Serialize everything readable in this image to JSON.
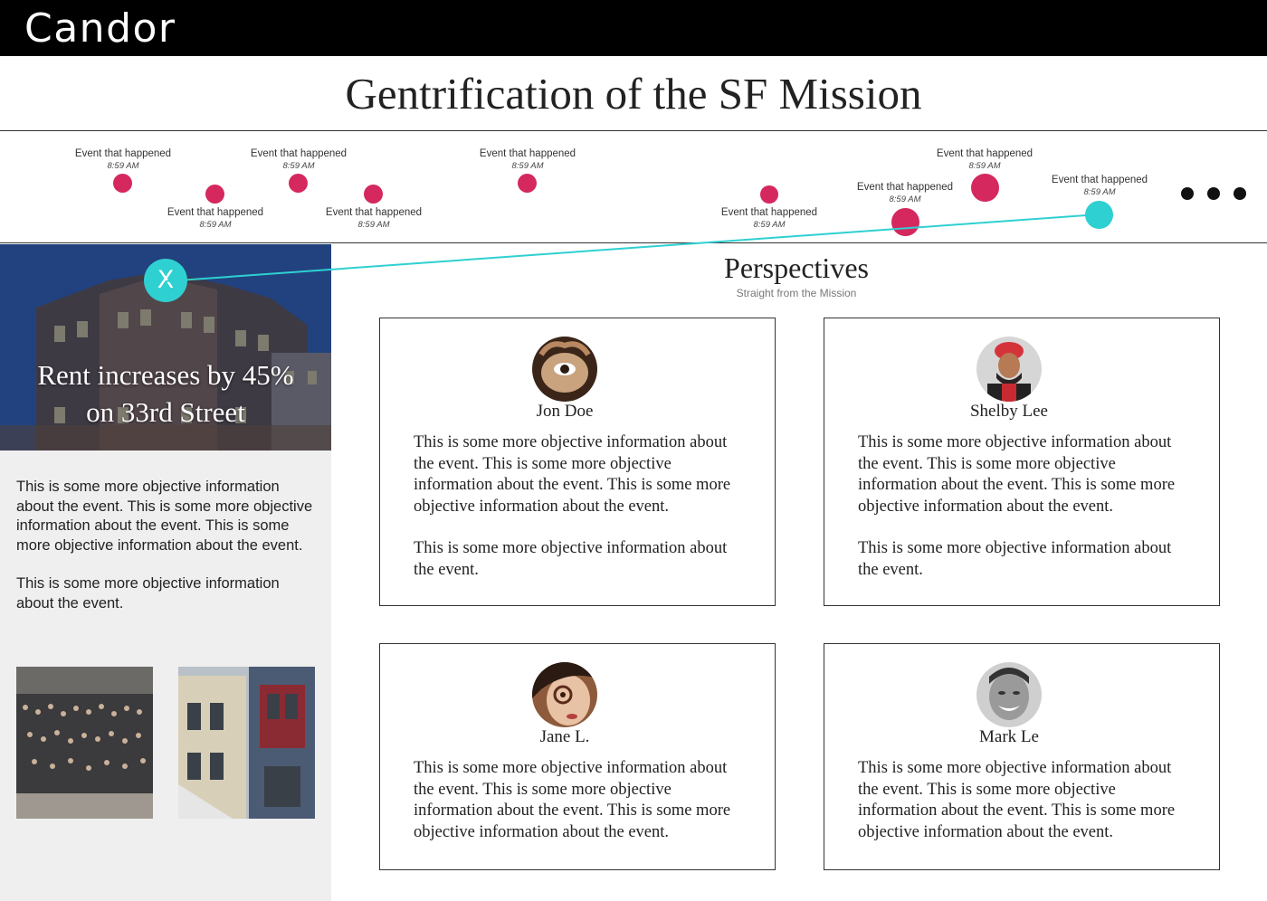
{
  "app": {
    "brand": "Candor"
  },
  "page": {
    "title": "Gentrification of the SF Mission"
  },
  "timeline": {
    "events": [
      {
        "label": "Event that happened",
        "time": "8:59 AM"
      },
      {
        "label": "Event that happened",
        "time": "8:59 AM"
      },
      {
        "label": "Event that happened",
        "time": "8:59 AM"
      },
      {
        "label": "Event that happened",
        "time": "8:59 AM"
      },
      {
        "label": "Event that happened",
        "time": "8:59 AM"
      },
      {
        "label": "Event that happened",
        "time": "8:59 AM"
      },
      {
        "label": "Event that happened",
        "time": "8:59 AM"
      },
      {
        "label": "Event that happened",
        "time": "8:59 AM"
      },
      {
        "label": "Event that happened",
        "time": "8:59 AM"
      }
    ]
  },
  "detail": {
    "title_line1": "Rent increases by 45%",
    "title_line2": "on 33rd Street",
    "close_label": "X",
    "paragraph1": "This is some more objective information about the event.  This is some more objective information about the event. This is some more objective information about the event.",
    "paragraph2": "This is some more objective information about the event."
  },
  "perspectives": {
    "title": "Perspectives",
    "subtitle": "Straight from the Mission",
    "cards": [
      {
        "name": "Jon Doe",
        "paragraph1": "This is some more objective information about the event.  This is some more objective information about the event.  This is some more objective information about the event.",
        "paragraph2": "This is some more objective information about the event."
      },
      {
        "name": "Shelby Lee",
        "paragraph1": "This is some more objective information about the event.  This is some more objective information about the event.  This is some more objective information about the event.",
        "paragraph2": "This is some more objective information about the event."
      },
      {
        "name": "Jane L.",
        "paragraph1": "This is some more objective information about the event.  This is some more objective information about the event.  This is some more objective information about the event.",
        "paragraph2": ""
      },
      {
        "name": "Mark Le",
        "paragraph1": "This is some more objective information about the event.  This is some more objective information about the event.  This is some more objective information about the event.",
        "paragraph2": ""
      }
    ]
  },
  "colors": {
    "event_dot": "#d4285e",
    "selected_dot": "#2fd0d2",
    "header_bg": "#000000",
    "panel_bg": "#efefef"
  }
}
